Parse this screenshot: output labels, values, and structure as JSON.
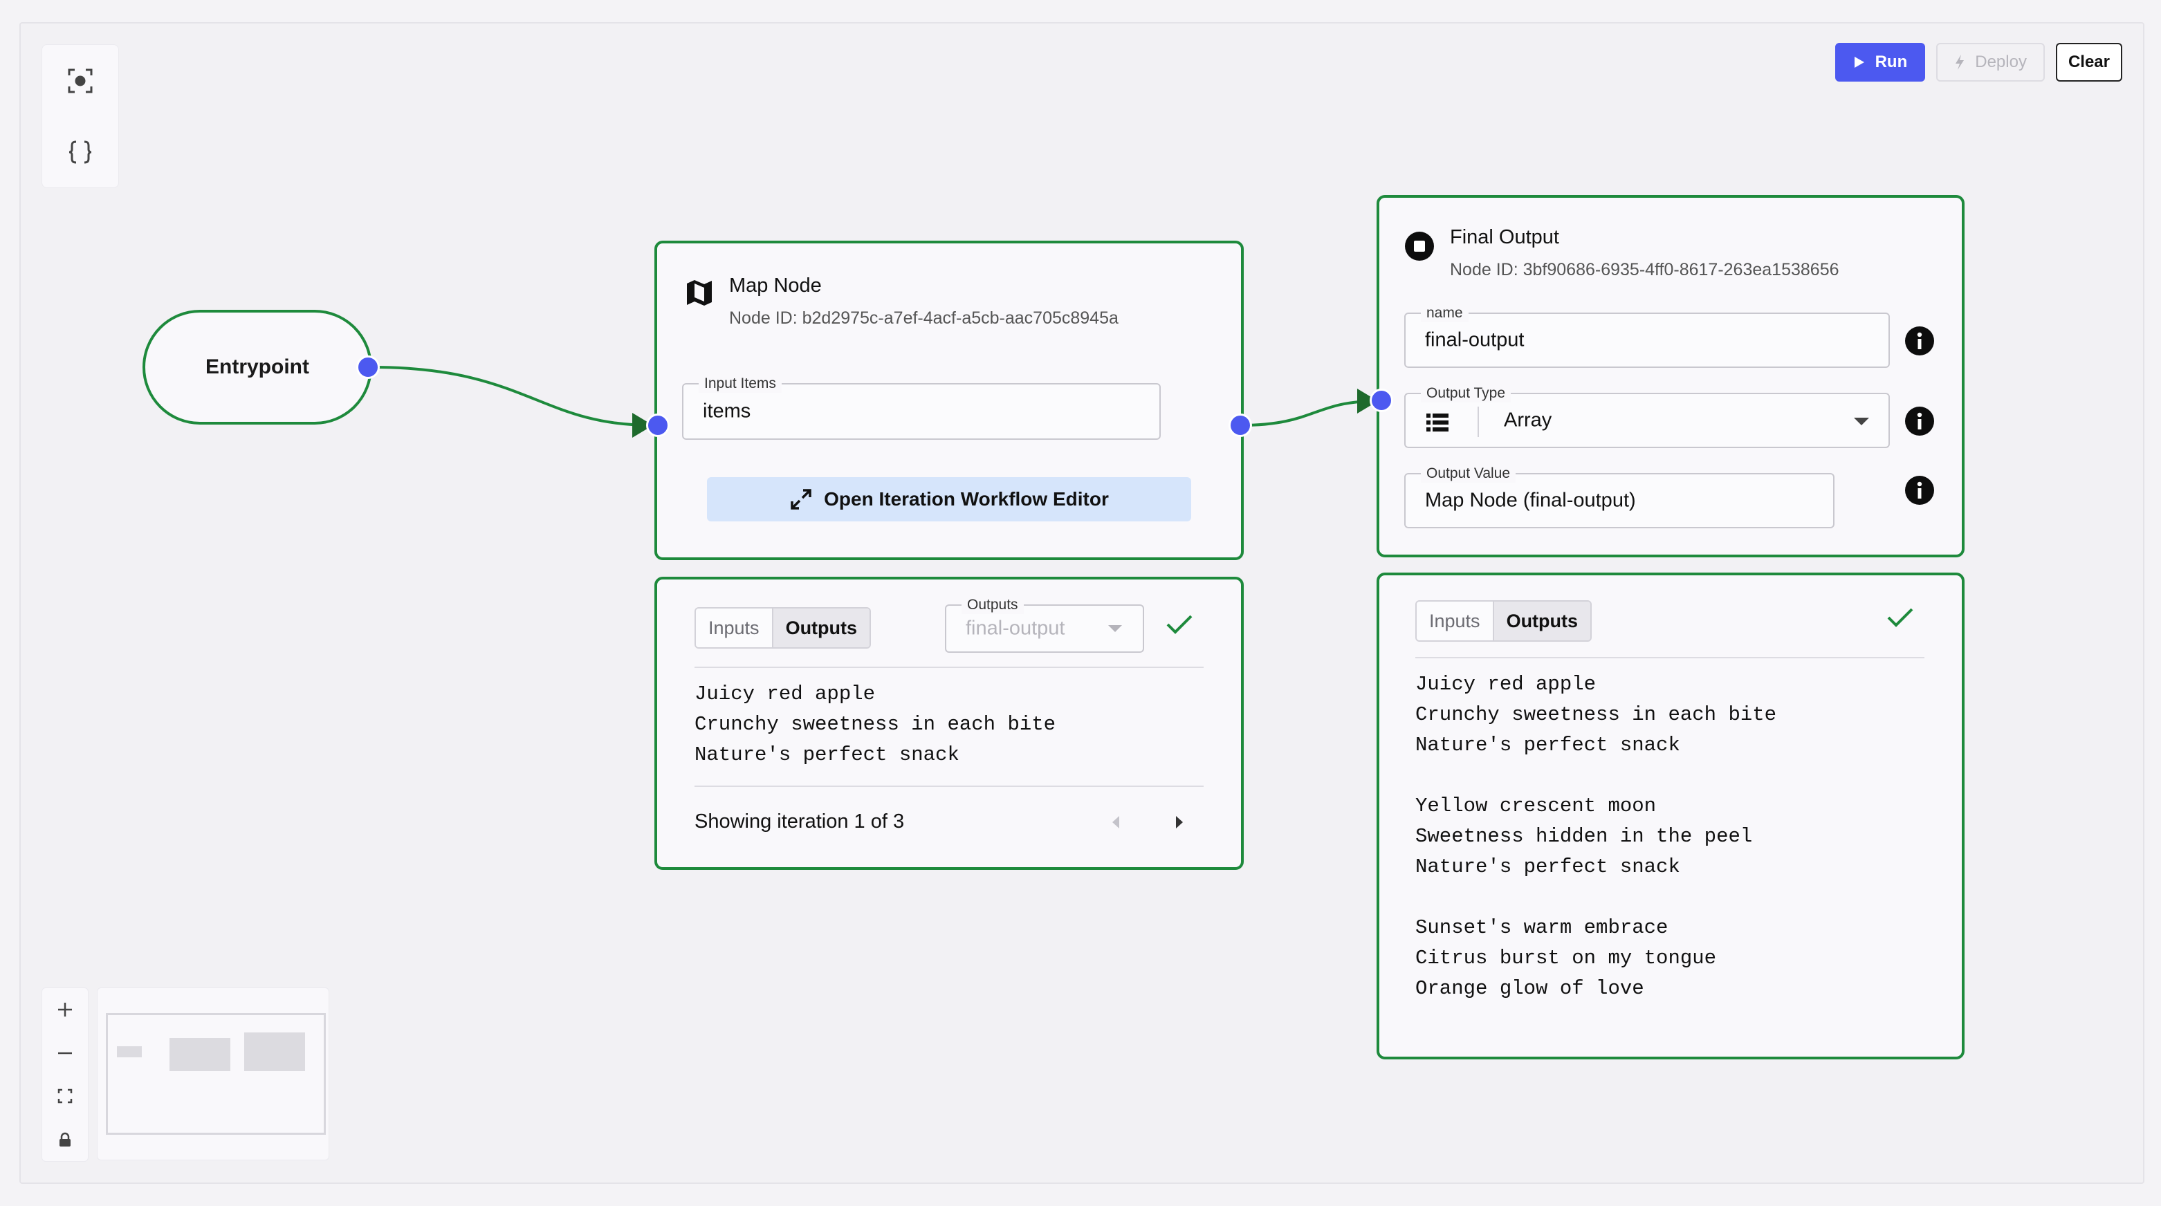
{
  "toolbar": {
    "run_label": "Run",
    "deploy_label": "Deploy",
    "clear_label": "Clear",
    "accent_color": "#4c59f0"
  },
  "tools": [
    "focus-icon",
    "braces-icon"
  ],
  "entrypoint": {
    "label": "Entrypoint"
  },
  "map_node": {
    "title": "Map Node",
    "node_id": "Node ID: b2d2975c-a7ef-4acf-a5cb-aac705c8945a",
    "input_items_label": "Input Items",
    "input_items_value": "items",
    "iteration_button_label": "Open Iteration Workflow Editor",
    "results": {
      "tab_inputs": "Inputs",
      "tab_outputs": "Outputs",
      "outputs_label": "Outputs",
      "outputs_selected": "final-output",
      "lines": [
        "Juicy red apple",
        "Crunchy sweetness in each bite",
        "Nature's perfect snack"
      ],
      "iteration_status": "Showing iteration 1 of 3"
    }
  },
  "final_output": {
    "title": "Final Output",
    "node_id": "Node ID: 3bf90686-6935-4ff0-8617-263ea1538656",
    "name_label": "name",
    "name_value": "final-output",
    "output_type_label": "Output Type",
    "output_type_value": "Array",
    "output_value_label": "Output Value",
    "output_value_value": "Map Node (final-output)",
    "results": {
      "tab_inputs": "Inputs",
      "tab_outputs": "Outputs",
      "lines": [
        "Juicy red apple",
        "Crunchy sweetness in each bite",
        "Nature's perfect snack",
        "",
        "Yellow crescent moon",
        "Sweetness hidden in the peel",
        "Nature's perfect snack",
        "",
        "Sunset's warm embrace",
        "Citrus burst on my tongue",
        "Orange glow of love"
      ]
    }
  },
  "node_border_color": "#1e8a3c",
  "handle_color": "#4c59f0"
}
